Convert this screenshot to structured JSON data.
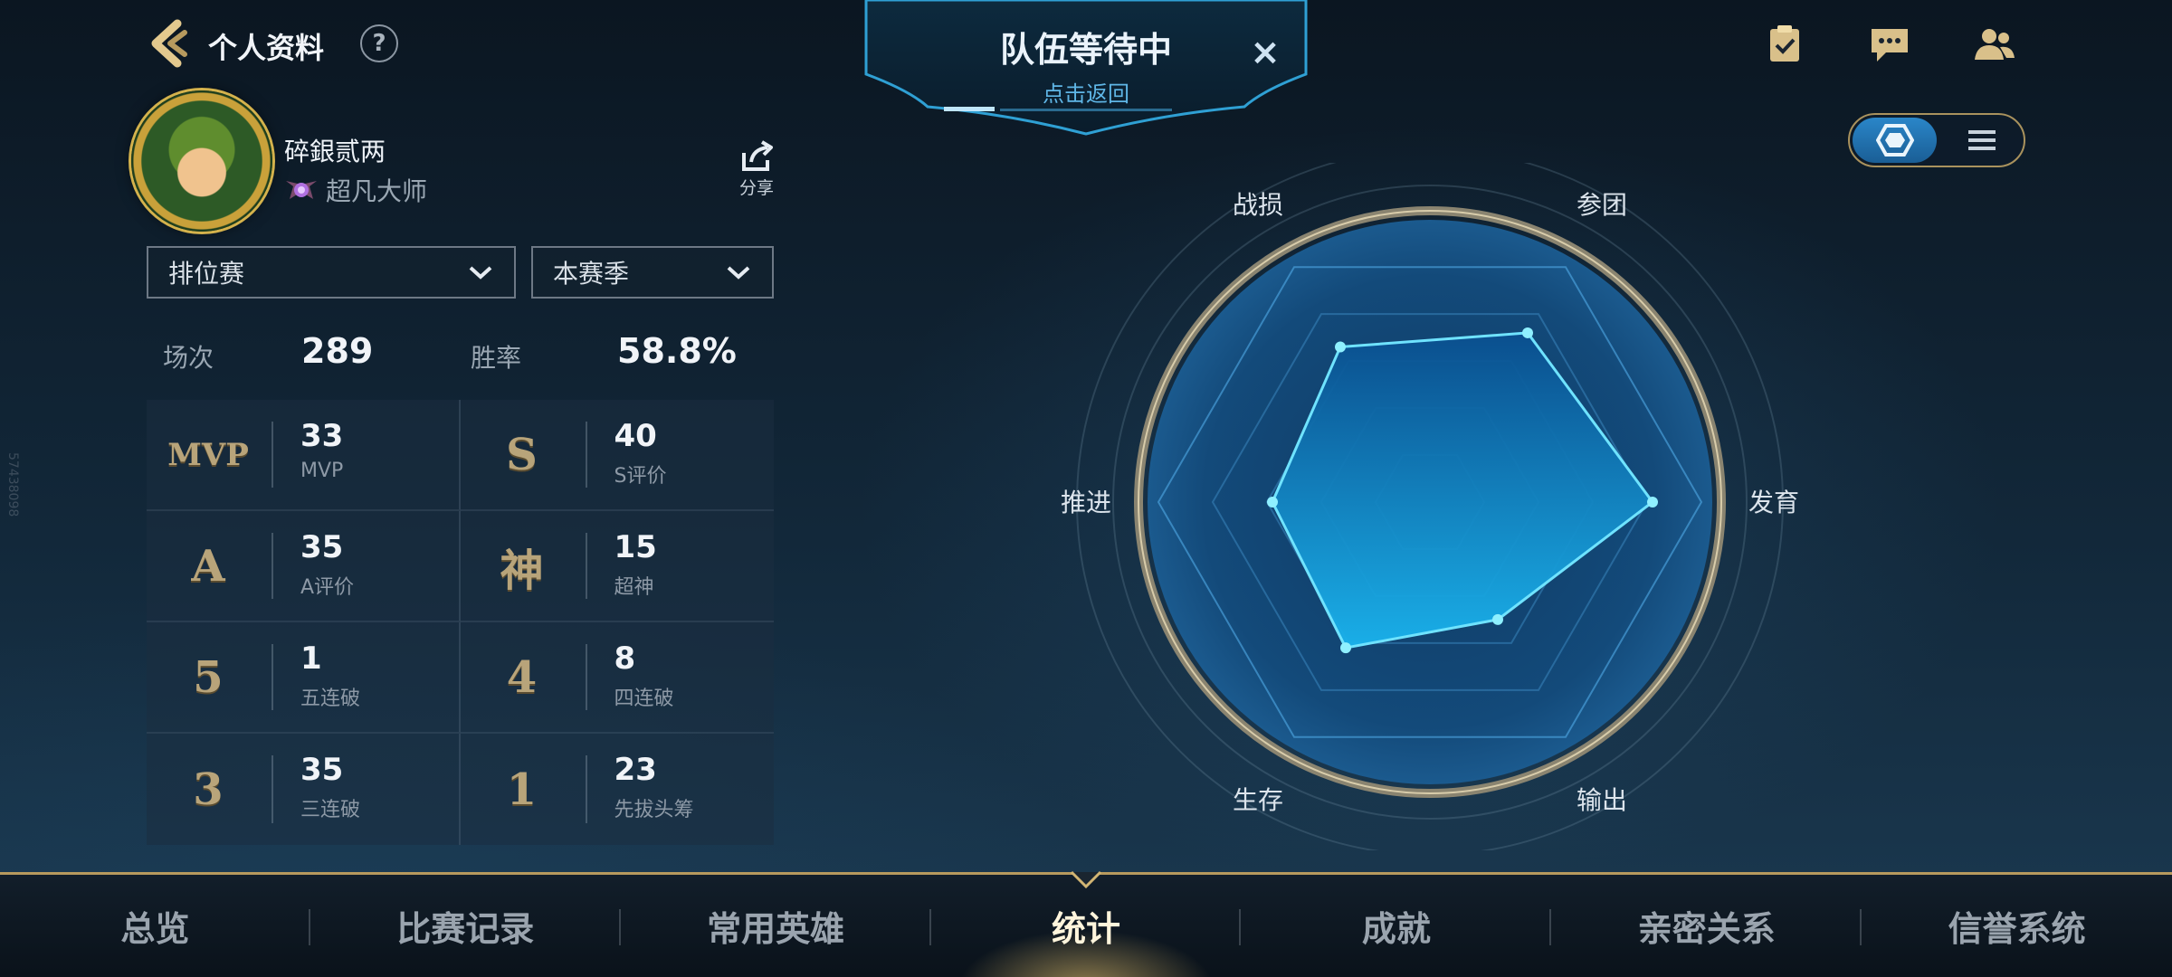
{
  "header": {
    "title": "个人资料"
  },
  "profile": {
    "name": "碎銀贰两",
    "rank": "超凡大师",
    "share_label": "分享"
  },
  "filters": {
    "mode": "排位赛",
    "season": "本赛季"
  },
  "summary": {
    "matches_label": "场次",
    "matches": "289",
    "winrate_label": "胜率",
    "winrate": "58.8%"
  },
  "stats": [
    {
      "badge": "MVP",
      "value": "33",
      "label": "MVP"
    },
    {
      "badge": "S",
      "value": "40",
      "label": "S评价"
    },
    {
      "badge": "A",
      "value": "35",
      "label": "A评价"
    },
    {
      "badge": "神",
      "value": "15",
      "label": "超神"
    },
    {
      "badge": "5",
      "value": "1",
      "label": "五连破"
    },
    {
      "badge": "4",
      "value": "8",
      "label": "四连破"
    },
    {
      "badge": "3",
      "value": "35",
      "label": "三连破"
    },
    {
      "badge": "1",
      "value": "23",
      "label": "先拔头筹"
    }
  ],
  "banner": {
    "title": "队伍等待中",
    "subtitle": "点击返回",
    "close": "×"
  },
  "radar": {
    "axes": [
      "参团",
      "发育",
      "输出",
      "生存",
      "推进",
      "战损"
    ],
    "levels": [
      0.72,
      0.82,
      0.5,
      0.62,
      0.58,
      0.66
    ]
  },
  "side_id": "57438098",
  "nav": {
    "items": [
      "总览",
      "比赛记录",
      "常用英雄",
      "统计",
      "成就",
      "亲密关系",
      "信誉系统"
    ],
    "active_index": 3
  },
  "colors": {
    "accent_gold": "#b79a5e",
    "radar_fill": "#1aa8e6",
    "banner_sub": "#5fb6e6"
  }
}
